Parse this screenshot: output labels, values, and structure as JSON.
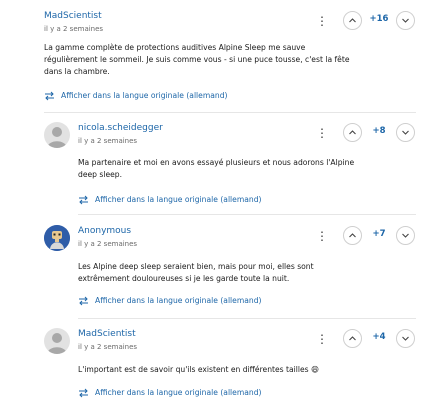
{
  "comments": [
    {
      "author": "MadScientist",
      "time": "il y a 2 semaines",
      "score": "+16",
      "text_lines": [
        "La gamme complète de protections auditives Alpine Sleep me sauve",
        "régulièrement le sommeil. Je suis comme vous - si une puce tousse, c'est la fête",
        "dans la chambre."
      ],
      "translate_label": "Afficher dans la langue originale (allemand)"
    },
    {
      "author": "nicola.scheidegger",
      "time": "il y a 2 semaines",
      "score": "+8",
      "text_lines": [
        "Ma partenaire et moi en avons essayé plusieurs et nous adorons l'Alpine",
        "deep sleep."
      ],
      "translate_label": "Afficher dans la langue originale (allemand)"
    },
    {
      "author": "Anonymous",
      "time": "il y a 2 semaines",
      "score": "+7",
      "text_lines": [
        "Les Alpine deep sleep seraient bien, mais pour moi, elles sont",
        "extrêmement douloureuses si je les garde toute la nuit."
      ],
      "translate_label": "Afficher dans la langue originale (allemand)"
    },
    {
      "author": "MadScientist",
      "time": "il y a 2 semaines",
      "score": "+4",
      "text_lines": [
        "L'important est de savoir qu'ils existent en différentes tailles 😄"
      ],
      "translate_label": "Afficher dans la langue originale (allemand)"
    }
  ],
  "icons": {
    "menu": "more-vertical-icon",
    "upvote": "chevron-up-icon",
    "downvote": "chevron-down-icon",
    "translate": "swap-arrows-icon"
  },
  "colors": {
    "link": "#1d66a8",
    "divider": "#e6e6e6",
    "muted": "#6a6a6a",
    "vote_border": "#cfcfcf"
  }
}
